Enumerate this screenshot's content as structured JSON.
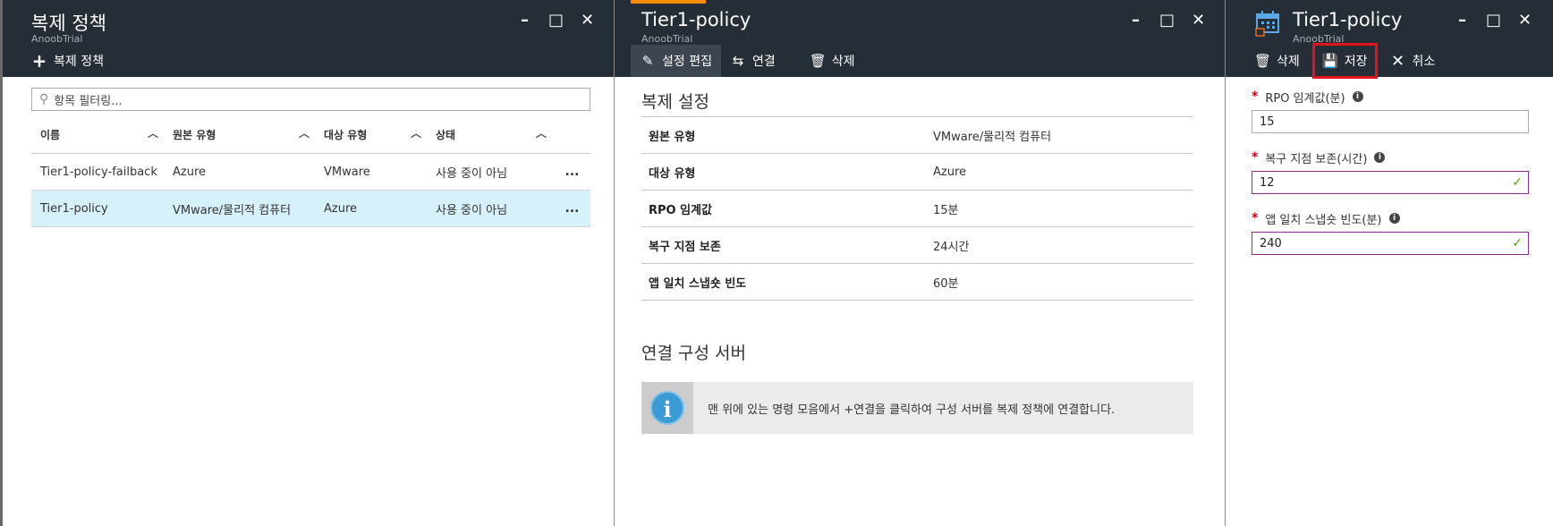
{
  "blade1": {
    "title": "복제 정책",
    "subtitle": "AnoobTrial",
    "add_label": "복제 정책",
    "filter_placeholder": "항목 필터링...",
    "columns": [
      "이름",
      "원본 유형",
      "대상 유형",
      "상태"
    ],
    "rows": [
      {
        "name": "Tier1-policy-failback",
        "source": "Azure",
        "target": "VMware",
        "status": "사용 중이 아님",
        "more": "...",
        "selected": false
      },
      {
        "name": "Tier1-policy",
        "source": "VMware/물리적 컴퓨터",
        "target": "Azure",
        "status": "사용 중이 아님",
        "more": "...",
        "selected": true
      }
    ]
  },
  "blade2": {
    "title": "Tier1-policy",
    "subtitle": "AnoobTrial",
    "toolbar": {
      "edit": "설정 편집",
      "associate": "연결",
      "delete": "삭제"
    },
    "settings_title": "복제 설정",
    "properties": [
      {
        "key": "원본 유형",
        "value": "VMware/물리적 컴퓨터"
      },
      {
        "key": "대상 유형",
        "value": "Azure"
      },
      {
        "key": "RPO 임계값",
        "value": "15분"
      },
      {
        "key": "복구 지점 보존",
        "value": "24시간"
      },
      {
        "key": "앱 일치 스냅숏 빈도",
        "value": "60분"
      }
    ],
    "associated_title": "연결 구성 서버",
    "info_message": "맨 위에 있는 명령 모음에서 +연결을 클릭하여 구성 서버를 복제 정책에 연결합니다."
  },
  "blade3": {
    "title": "Tier1-policy",
    "subtitle": "AnoobTrial",
    "toolbar": {
      "delete": "삭제",
      "save": "저장",
      "discard": "취소"
    },
    "fields": [
      {
        "label": "RPO 임계값(분)",
        "value": "15",
        "valid": false
      },
      {
        "label": "복구 지점 보존(시간)",
        "value": "12",
        "valid": true
      },
      {
        "label": "앱 일치 스냅숏 빈도(분)",
        "value": "240",
        "valid": true
      }
    ]
  },
  "window_controls": {
    "minimize": "–",
    "maximize": "□",
    "close": "✕"
  },
  "colors": {
    "header": "#252d36",
    "accent": "#ff8c00",
    "selected_row": "#d7f1fa",
    "highlight_box": "#e0141e",
    "info_icon": "#3a9bd5",
    "valid_check": "#5ba000"
  }
}
